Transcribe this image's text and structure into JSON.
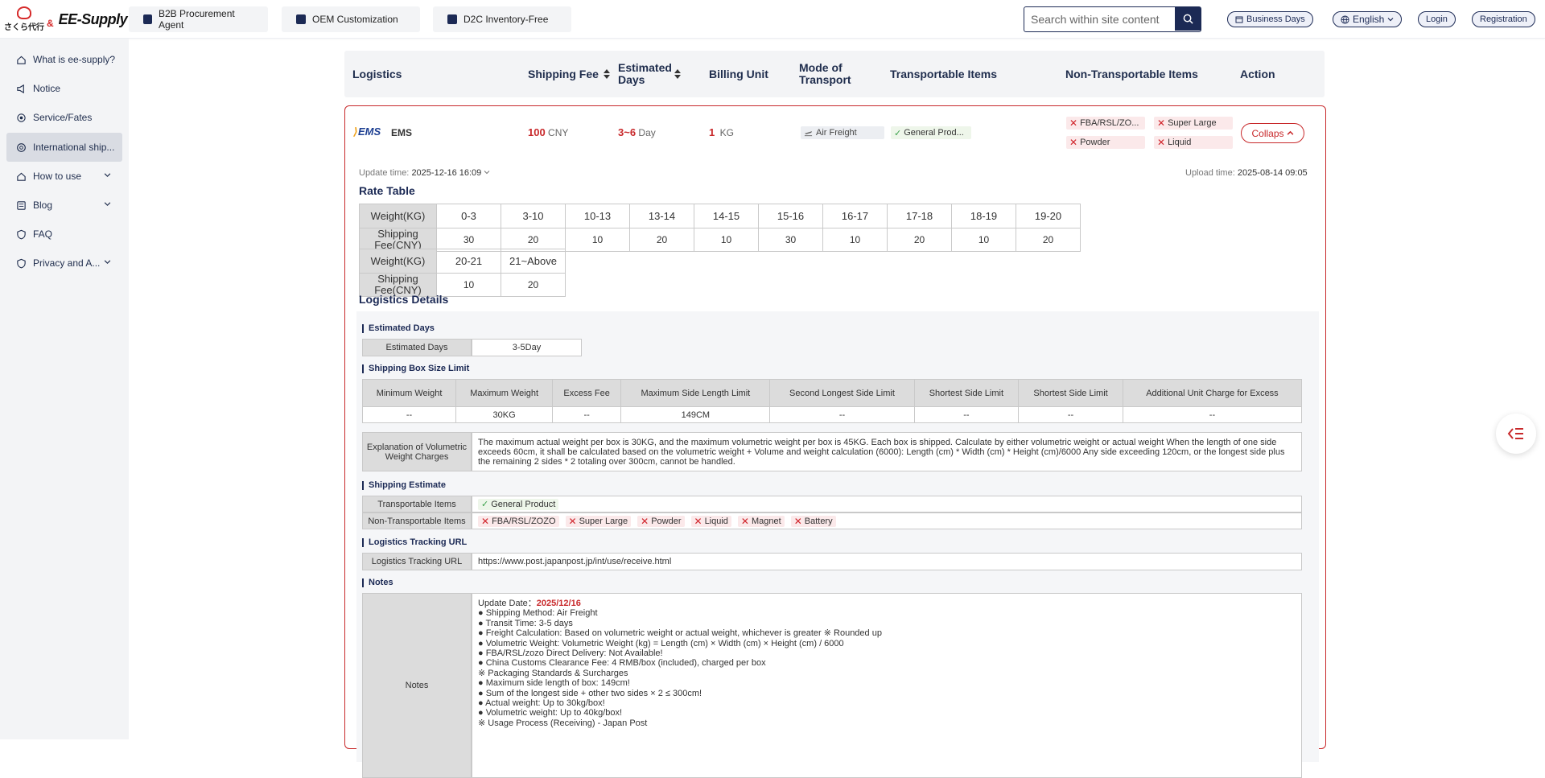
{
  "brand": {
    "jp_name": "さくら代行",
    "amp": "&",
    "ee_name": "EE-Supply"
  },
  "top_tabs": [
    "B2B Procurement Agent",
    "OEM Customization",
    "D2C Inventory-Free"
  ],
  "search": {
    "placeholder": "Search within site content"
  },
  "header_actions": {
    "business_days": "Business Days",
    "language": "English",
    "login": "Login",
    "registration": "Registration"
  },
  "sidebar": {
    "items": [
      {
        "label": "What is ee-supply?",
        "icon": "home-icon"
      },
      {
        "label": "Notice",
        "icon": "megaphone-icon"
      },
      {
        "label": "Service/Fates",
        "icon": "service-icon"
      },
      {
        "label": "International ship...",
        "icon": "globe-icon"
      },
      {
        "label": "How to use",
        "icon": "home-icon"
      },
      {
        "label": "Blog",
        "icon": "blog-icon"
      },
      {
        "label": "FAQ",
        "icon": "shield-icon"
      },
      {
        "label": "Privacy and A...",
        "icon": "shield-icon"
      }
    ]
  },
  "table_header": {
    "logistics": "Logistics",
    "shipping_fee": "Shipping Fee",
    "estimated_days": "Estimated Days",
    "billing_unit": "Billing Unit",
    "mode_of_transport": "Mode of Transport",
    "transportable_items": "Transportable Items",
    "non_transportable_items": "Non-Transportable Items",
    "action": "Action"
  },
  "row": {
    "name": "EMS",
    "logo_text": "EMS",
    "fee": "100",
    "fee_unit": "CNY",
    "days": "3~6",
    "days_unit": "Day",
    "billing": "1",
    "billing_unit": "KG",
    "transport": "Air Freight",
    "transportable": "General Prod...",
    "non_transportable": [
      "FBA/RSL/ZO...",
      "Super Large",
      "Powder",
      "Liquid"
    ],
    "collapse": "Collaps"
  },
  "detail": {
    "update_label": "Update time:",
    "update_value": "2025-12-16 16:09",
    "upload_label": "Upload time:",
    "upload_value": "2025-08-14 09:05",
    "rate_table_title": "Rate Table",
    "rate_header_weight": "Weight(KG)",
    "rate_header_fee": "Shipping Fee(CNY)",
    "rate_row1": {
      "weights": [
        "0-3",
        "3-10",
        "10-13",
        "13-14",
        "14-15",
        "15-16",
        "16-17",
        "17-18",
        "18-19",
        "19-20"
      ],
      "fees": [
        "30",
        "20",
        "10",
        "20",
        "10",
        "30",
        "10",
        "20",
        "10",
        "20"
      ]
    },
    "rate_row2": {
      "weights": [
        "20-21",
        "21~Above"
      ],
      "fees": [
        "10",
        "20"
      ]
    },
    "logistics_details_title": "Logistics Details",
    "est_days_title": "Estimated Days",
    "est_days_label": "Estimated Days",
    "est_days_value": "3-5Day",
    "box_limit_title": "Shipping Box Size Limit",
    "box_headers": [
      "Minimum Weight",
      "Maximum Weight",
      "Excess Fee",
      "Maximum Side Length Limit",
      "Second Longest Side Limit",
      "Shortest Side Limit",
      "Shortest Side Limit",
      "Additional Unit Charge for Excess"
    ],
    "box_values": [
      "--",
      "30KG",
      "--",
      "149CM",
      "--",
      "--",
      "--",
      "--"
    ],
    "vol_label": "Explanation of Volumetric Weight Charges",
    "vol_text": "The maximum actual weight per box is 30KG, and the maximum volumetric weight per box is 45KG. Each box is shipped. Calculate by either volumetric weight or actual weight When the length of one side exceeds 60cm, it shall be calculated based on the volumetric weight + Volume and weight calculation (6000): Length (cm) * Width (cm) * Height (cm)/6000 Any side exceeding 120cm, or the longest side plus the remaining 2 sides * 2 totaling over 300cm, cannot be handled.",
    "estimate_title": "Shipping Estimate",
    "est_transportable_label": "Transportable Items",
    "est_transportable": "General Product",
    "est_non_label": "Non-Transportable Items",
    "est_non": [
      "FBA/RSL/ZOZO",
      "Super Large",
      "Powder",
      "Liquid",
      "Magnet",
      "Battery"
    ],
    "tracking_title": "Logistics Tracking URL",
    "tracking_label": "Logistics Tracking URL",
    "tracking_value": "https://www.post.japanpost.jp/int/use/receive.html",
    "notes_title": "Notes",
    "notes_label": "Notes",
    "notes_update_label": "Update Date：",
    "notes_update_value": "2025/12/16",
    "notes_lines": [
      "● Shipping Method: Air Freight",
      "● Transit Time: 3-5 days",
      "● Freight Calculation: Based on volumetric weight or actual weight, whichever is greater ※ Rounded up",
      "● Volumetric Weight: Volumetric Weight (kg) = Length (cm) × Width (cm) × Height (cm) / 6000",
      "● FBA/RSL/zozo Direct Delivery: Not Available!",
      "● China Customs Clearance Fee: 4 RMB/box (included), charged per box",
      "",
      "※ Packaging Standards & Surcharges",
      "● Maximum side length of box: 149cm!",
      "● Sum of the longest side + other two sides × 2 ≤ 300cm!",
      "● Actual weight: Up to 30kg/box!",
      "● Volumetric weight: Up to 40kg/box!",
      "",
      "※ Usage Process (Receiving) - Japan Post"
    ]
  }
}
